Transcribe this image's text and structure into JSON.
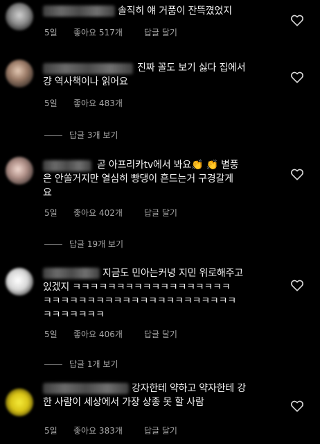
{
  "comments": [
    {
      "lines": [
        "솔직히 얘 거품이 잔뜩꼈었지"
      ],
      "age": "5일",
      "likes": "좋아요 517개",
      "reply_label": "답글 달기"
    },
    {
      "lines": [
        "진짜 꼴도 보기 싫다 집에서",
        "걍 역사책이나 읽어요"
      ],
      "age": "5일",
      "likes": "좋아요 483개",
      "view_replies": "답글 3개 보기"
    },
    {
      "lines": [
        "곧 아프리카tv에서 봐요👏 👏 별풍",
        "은 안쏠거지만 열심히 빵댕이 흔드는거 구경갈게",
        "요"
      ],
      "age": "5일",
      "likes": "좋아요 402개",
      "reply_label": "답글 달기",
      "view_replies": "답글 19개 보기"
    },
    {
      "lines": [
        "지금도 민아는커녕 지민 위로해주고",
        "있겠지 ㅋㅋㅋㅋㅋㅋㅋㅋㅋㅋㅋㅋㅋㅋㅋㅋㅋㅋ",
        "ㅋㅋㅋㅋㅋㅋㅋㅋㅋㅋㅋㅋㅋㅋㅋㅋㅋㅋㅋㅋㅋㅋ",
        "ㅋㅋㅋㅋㅋㅋㅋ"
      ],
      "age": "5일",
      "likes": "좋아요 406개",
      "reply_label": "답글 달기",
      "view_replies": "답글 1개 보기"
    },
    {
      "lines": [
        "강자한테 약하고 약자한테 강",
        "한 사람이 세상에서 가장 상종 못 할 사람"
      ],
      "age": "5일",
      "likes": "좋아요 383개",
      "reply_label": "답글 달기"
    }
  ],
  "icons": {
    "like": "heart-outline-icon"
  }
}
